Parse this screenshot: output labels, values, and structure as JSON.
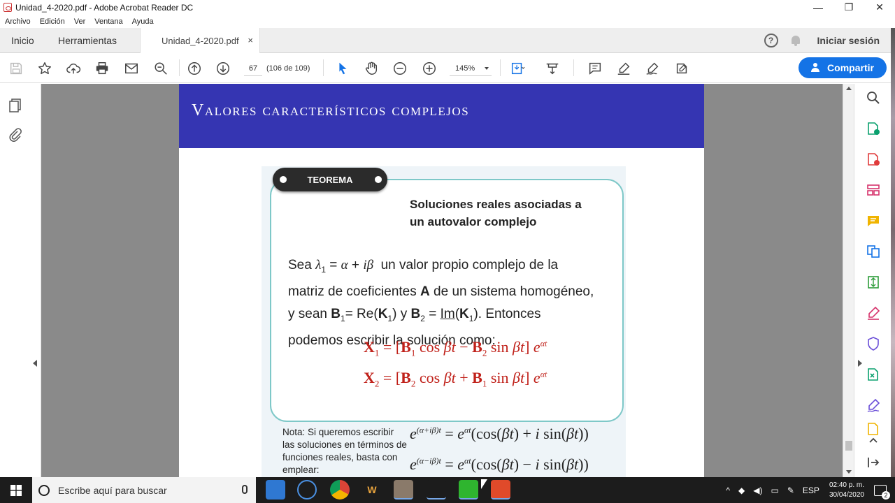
{
  "window": {
    "title": "Unidad_4-2020.pdf - Adobe Acrobat Reader DC",
    "minimize": "—",
    "maximize": "❐",
    "close": "✕"
  },
  "menu": [
    "Archivo",
    "Edición",
    "Ver",
    "Ventana",
    "Ayuda"
  ],
  "tabs": {
    "home": "Inicio",
    "tools": "Herramientas",
    "document": "Unidad_4-2020.pdf",
    "close": "×",
    "help": "?",
    "signin": "Iniciar sesión"
  },
  "toolbar": {
    "page_number": "67",
    "page_total": "(106 de 109)",
    "zoom": "145%",
    "share": "Compartir"
  },
  "document": {
    "banner_title": "Valores característicos complejos",
    "pill_label": "TEOREMA",
    "theorem_heading_line1": "Soluciones reales asociadas a",
    "theorem_heading_line2": "un autovalor complejo",
    "note": "Nota: Si queremos escribir las soluciones en términos de funciones reales, basta con emplear:"
  },
  "taskbar": {
    "search_placeholder": "Escribe aquí para buscar",
    "language": "ESP",
    "time": "02:40 p. m.",
    "date": "30/04/2020",
    "notifications": "2"
  },
  "colors": {
    "banner": "#3535b2",
    "formula_red": "#c0211a",
    "share_blue": "#1473e6",
    "box_border": "#7ec8c8"
  }
}
